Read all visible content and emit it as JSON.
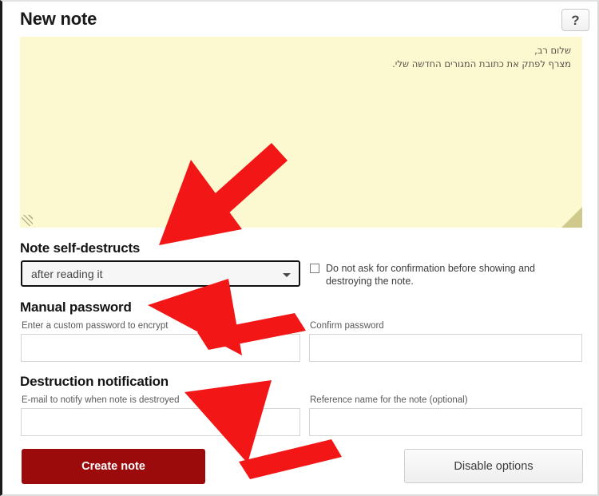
{
  "header": {
    "title": "New note",
    "help_label": "?"
  },
  "note": {
    "body": "שלום רב,\nמצרף לפתק את כתובת המגורים החדשה שלי.",
    "background_color": "#fcf8d0"
  },
  "self_destruct": {
    "heading": "Note self-destructs",
    "selected_option": "after reading it",
    "options": [
      "after reading it"
    ],
    "confirm_checkbox": {
      "label": "Do not ask for confirmation before showing and destroying the note.",
      "checked": false
    }
  },
  "manual_password": {
    "heading": "Manual password",
    "password_label": "Enter a custom password to encrypt",
    "password_value": "",
    "confirm_label": "Confirm password",
    "confirm_value": ""
  },
  "destruction_notification": {
    "heading": "Destruction notification",
    "email_label": "E-mail to notify when note is destroyed",
    "email_value": "",
    "reference_label": "Reference name for the note (optional)",
    "reference_value": ""
  },
  "footer": {
    "create_label": "Create note",
    "disable_label": "Disable options"
  },
  "annotations": {
    "arrow_color": "#f21616",
    "arrows": [
      {
        "name": "arrow-to-note-self-destructs",
        "points_to": "Note self-destructs"
      },
      {
        "name": "arrow-to-manual-password",
        "points_to": "Manual password"
      },
      {
        "name": "arrow-to-destruction-notification",
        "points_to": "Destruction notification"
      }
    ]
  },
  "colors": {
    "accent_red": "#9c0b0b",
    "note_yellow": "#fcf8d0",
    "arrow_red": "#f21616"
  }
}
